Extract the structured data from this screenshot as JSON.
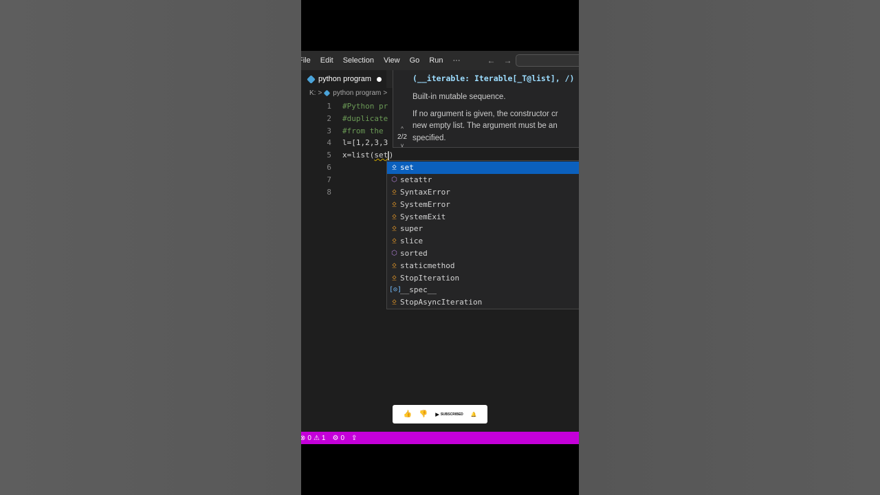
{
  "menu": {
    "file": "File",
    "edit": "Edit",
    "selection": "Selection",
    "view": "View",
    "go": "Go",
    "run": "Run",
    "more": "···"
  },
  "icons": {
    "back": "←",
    "forward": "→",
    "chevron_up": "^",
    "chevron_down": "v",
    "class": "⍚",
    "function": "⬡",
    "variable": "[⊙]",
    "error": "⊗",
    "warning": "⚠",
    "ports": "⚙",
    "broadcast": "⇪",
    "thumb_up": "👍",
    "thumb_down": "👎",
    "youtube": "▶",
    "bell": "🔔"
  },
  "tab": {
    "label": "python program"
  },
  "breadcrumb": {
    "drive": "K:",
    "sep": ">",
    "file": "python program",
    "sep2": ">"
  },
  "editor": {
    "line_numbers": [
      "1",
      "2",
      "3",
      "4",
      "5",
      "6",
      "7",
      "8"
    ],
    "lines": {
      "l1": "#Python pr",
      "l2": "#duplicate",
      "l3": "#from the",
      "l4": "l=[1,2,3,3",
      "l5_prefix": "x=list(",
      "l5_typed": "set",
      "l5_suffix": ")"
    }
  },
  "hover": {
    "signature": "(__iterable: Iterable[_T@list], /)",
    "overload": "2/2",
    "doc_1": "Built-in mutable sequence.",
    "doc_2a": "If no argument is given, the constructor cr",
    "doc_2b": "new empty list. The argument must be an",
    "doc_2c": "specified."
  },
  "suggestions": [
    {
      "label": "set",
      "kind": "class"
    },
    {
      "label": "setattr",
      "kind": "function"
    },
    {
      "label": "SyntaxError",
      "kind": "class"
    },
    {
      "label": "SystemError",
      "kind": "class"
    },
    {
      "label": "SystemExit",
      "kind": "class"
    },
    {
      "label": "super",
      "kind": "class"
    },
    {
      "label": "slice",
      "kind": "class"
    },
    {
      "label": "sorted",
      "kind": "function"
    },
    {
      "label": "staticmethod",
      "kind": "class"
    },
    {
      "label": "StopIteration",
      "kind": "class"
    },
    {
      "label": "__spec__",
      "kind": "variable"
    },
    {
      "label": "StopAsyncIteration",
      "kind": "class"
    }
  ],
  "subscribe": {
    "label": "SUBSCRIBED"
  },
  "status": {
    "errors": "0",
    "warnings": "1",
    "ports": "0"
  },
  "colors": {
    "status_bar": "#c400d9",
    "selection": "#0b60bd",
    "class_icon": "#ee9d28",
    "function_icon": "#b180d7",
    "variable_icon": "#75beff"
  }
}
